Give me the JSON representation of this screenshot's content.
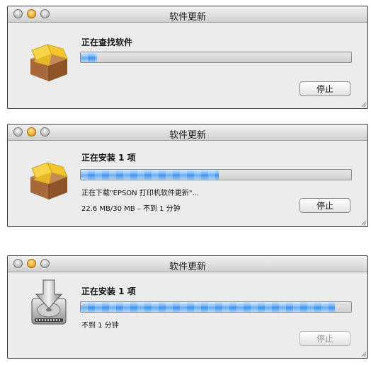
{
  "window1": {
    "title": "软件更新",
    "heading": "正在查找软件",
    "progress": 0.06,
    "stop_label": "停止",
    "stop_enabled": true
  },
  "window2": {
    "title": "软件更新",
    "heading": "正在安装 1 项",
    "progress": 0.51,
    "status_line": "正在下载\"EPSON 打印机软件更新\"...",
    "size_line": "22.6 MB/30 MB – 不到 1 分钟",
    "stop_label": "停止",
    "stop_enabled": true
  },
  "window3": {
    "title": "软件更新",
    "heading": "正在安装 1 项",
    "progress": 0.94,
    "status_line": "不到 1 分钟",
    "stop_label": "停止",
    "stop_enabled": false
  },
  "icons": {
    "package": "package-box-icon",
    "disk": "hard-disk-install-icon"
  }
}
